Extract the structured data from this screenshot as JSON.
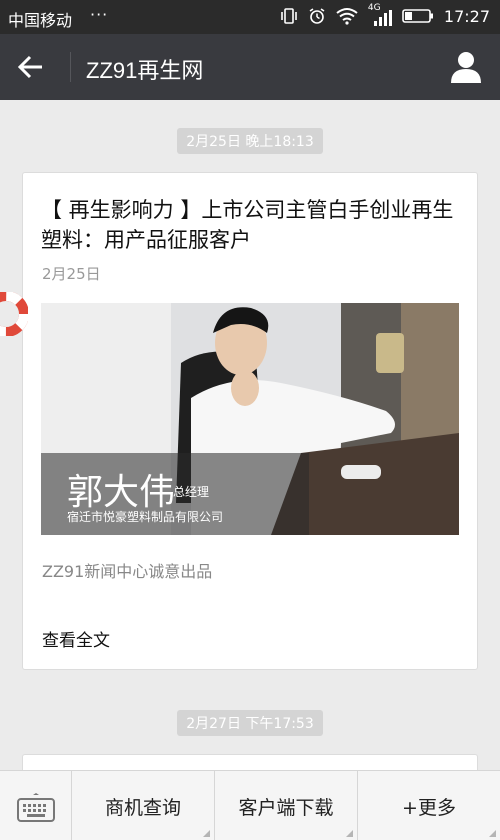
{
  "status_bar": {
    "carrier": "中国移动",
    "dots": "···",
    "network": "4G",
    "time": "17:27"
  },
  "title_bar": {
    "title": "ZZ91再生网"
  },
  "messages": [
    {
      "timestamp": "2月25日 晚上18:13",
      "headline": "【 再生影响力 】上市公司主管白手创业再生塑料：用产品征服客户",
      "date": "2月25日",
      "cover": {
        "name": "郭大伟",
        "role": "总经理",
        "company": "宿迁市悦豪塑料制品有限公司"
      },
      "summary": "ZZ91新闻中心诚意出品",
      "read_more": "查看全文"
    },
    {
      "timestamp": "2月27日 下午17:53"
    }
  ],
  "bottom_menu": {
    "items": [
      "商机查询",
      "客户端下载",
      "+更多"
    ]
  },
  "colors": {
    "title_bar_bg": "#393a3f",
    "status_bar_bg": "#2b2b2b",
    "chat_bg": "#ebebeb",
    "timestamp_bg": "#d4d4d4"
  }
}
